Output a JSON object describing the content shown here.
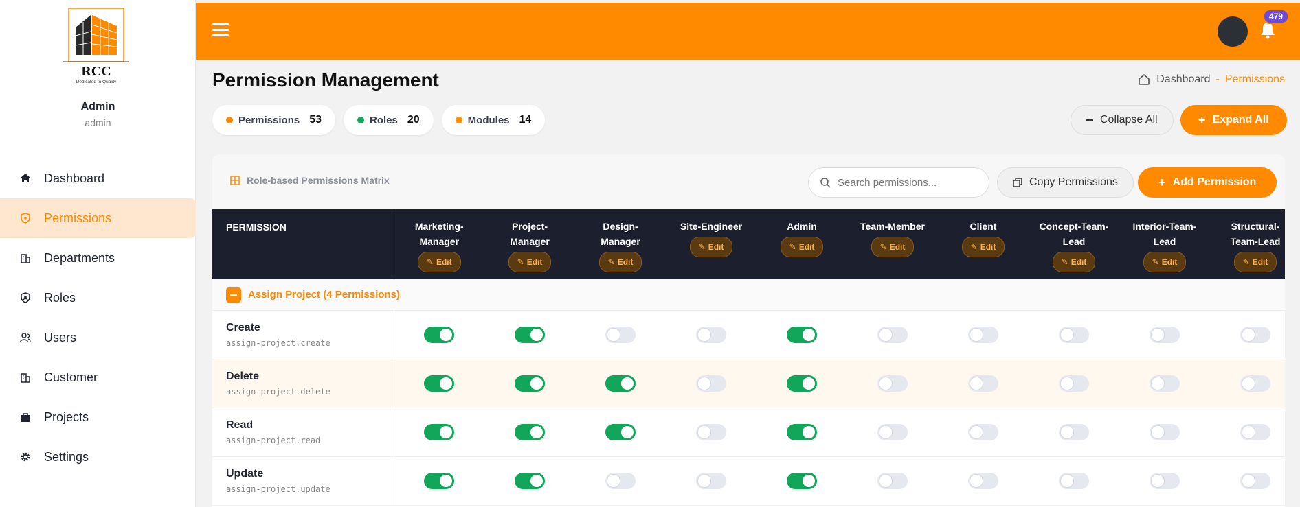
{
  "brand": {
    "name": "RCC",
    "tagline": "Dedicated to Quality"
  },
  "user": {
    "name": "Admin",
    "role": "admin"
  },
  "nav": [
    {
      "label": "Dashboard",
      "icon": "home-icon",
      "active": false
    },
    {
      "label": "Permissions",
      "icon": "shield-icon",
      "active": true
    },
    {
      "label": "Departments",
      "icon": "building-icon",
      "active": false
    },
    {
      "label": "Roles",
      "icon": "badge-icon",
      "active": false
    },
    {
      "label": "Users",
      "icon": "users-icon",
      "active": false
    },
    {
      "label": "Customer",
      "icon": "building-icon",
      "active": false
    },
    {
      "label": "Projects",
      "icon": "briefcase-icon",
      "active": false
    },
    {
      "label": "Settings",
      "icon": "gear-icon",
      "active": false
    }
  ],
  "topbar": {
    "notification_count": "479",
    "accent": "#ff8a00"
  },
  "page": {
    "title": "Permission Management"
  },
  "breadcrumb": {
    "home": "Dashboard",
    "separator": "-",
    "current": "Permissions"
  },
  "stats": [
    {
      "label": "Permissions",
      "value": "53",
      "color": "#ff8a00"
    },
    {
      "label": "Roles",
      "value": "20",
      "color": "#11a65a"
    },
    {
      "label": "Modules",
      "value": "14",
      "color": "#ff8a00"
    }
  ],
  "actions": {
    "collapse": "Collapse All",
    "expand": "Expand All",
    "copy": "Copy Permissions",
    "add": "Add Permission"
  },
  "matrix": {
    "title": "Role-based Permissions Matrix",
    "search_placeholder": "Search permissions...",
    "permission_header": "PERMISSION",
    "edit_label": "Edit",
    "roles": [
      [
        "Marketing-",
        "Manager"
      ],
      [
        "Project-",
        "Manager"
      ],
      [
        "Design-",
        "Manager"
      ],
      [
        "Site-Engineer"
      ],
      [
        "Admin"
      ],
      [
        "Team-Member"
      ],
      [
        "Client"
      ],
      [
        "Concept-Team-",
        "Lead"
      ],
      [
        "Interior-Team-",
        "Lead"
      ],
      [
        "Structural-",
        "Team-Lead"
      ]
    ],
    "group": {
      "label": "Assign Project (4 Permissions)"
    },
    "rows": [
      {
        "name": "Create",
        "code": "assign-project.create",
        "values": [
          1,
          1,
          0,
          0,
          1,
          0,
          0,
          0,
          0,
          0
        ]
      },
      {
        "name": "Delete",
        "code": "assign-project.delete",
        "values": [
          1,
          1,
          1,
          0,
          1,
          0,
          0,
          0,
          0,
          0
        ]
      },
      {
        "name": "Read",
        "code": "assign-project.read",
        "values": [
          1,
          1,
          1,
          0,
          1,
          0,
          0,
          0,
          0,
          0
        ]
      },
      {
        "name": "Update",
        "code": "assign-project.update",
        "values": [
          1,
          1,
          0,
          0,
          1,
          0,
          0,
          0,
          0,
          0
        ]
      }
    ]
  }
}
